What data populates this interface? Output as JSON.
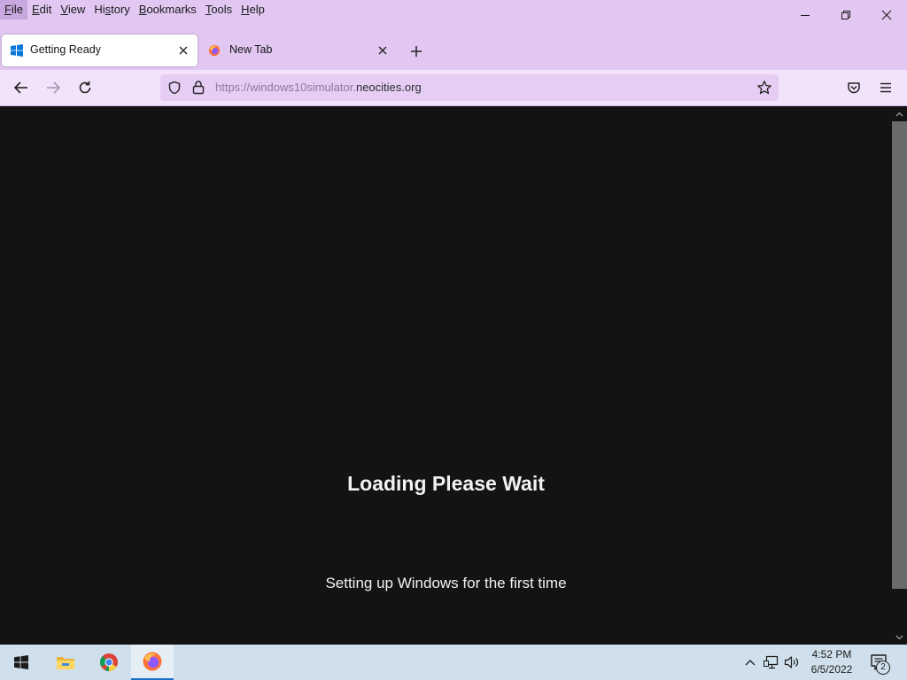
{
  "menu": {
    "items": [
      "File",
      "Edit",
      "View",
      "History",
      "Bookmarks",
      "Tools",
      "Help"
    ],
    "underline": [
      "F",
      "E",
      "V",
      "s",
      "B",
      "T",
      "H"
    ]
  },
  "tabs": [
    {
      "title": "Getting Ready",
      "favicon": "windows-logo-icon",
      "selected": true
    },
    {
      "title": "New Tab",
      "favicon": "firefox-icon",
      "selected": false
    }
  ],
  "urlbar": {
    "prefix": "https://windows10simulator.",
    "host": "neocities.org"
  },
  "page": {
    "title": "Loading Please Wait",
    "subtitle": "Setting up Windows for the first time"
  },
  "taskbar": {
    "time": "4:52 PM",
    "date": "6/5/2022",
    "notification_count": "2"
  },
  "colors": {
    "chrome_bg": "#e1c7f1",
    "navbar_bg": "#f2e3fb",
    "urlbar_bg": "#e5cdf4",
    "content_bg": "#141314",
    "taskbar_bg": "#cfe0ec",
    "accent": "#1a73c8"
  }
}
